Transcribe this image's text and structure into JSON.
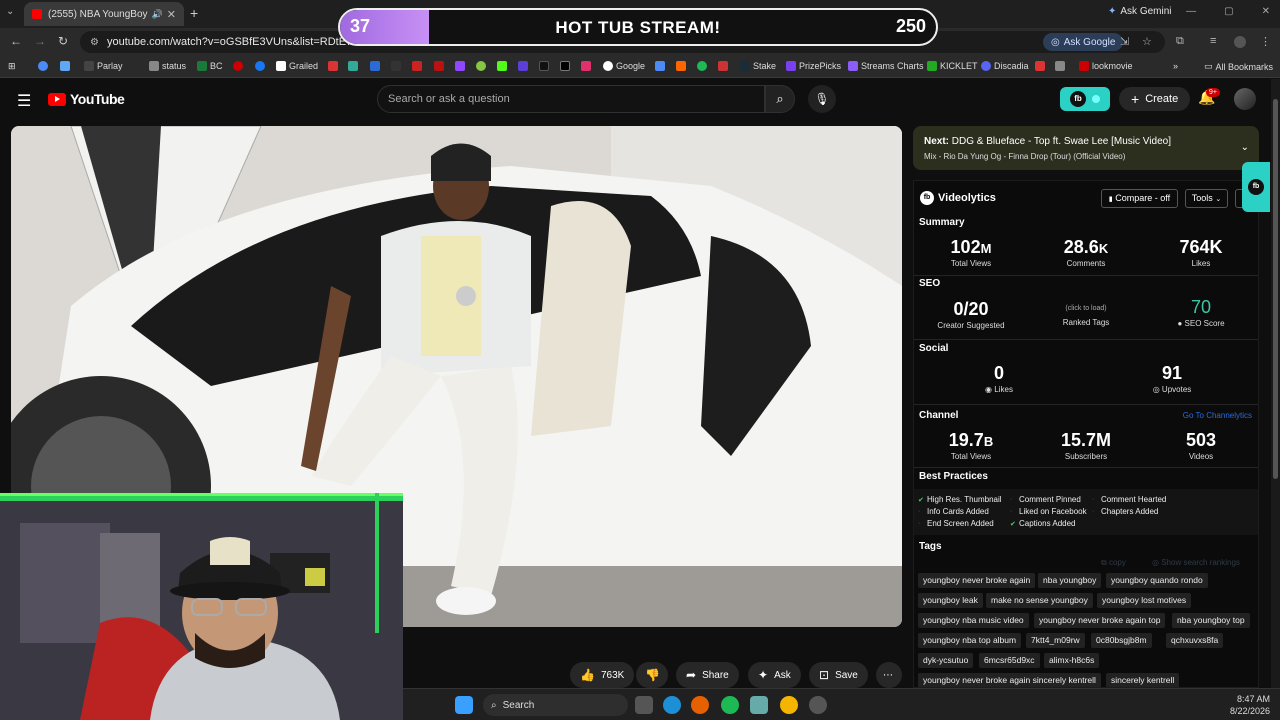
{
  "browser": {
    "tab_title": "(2555) NBA YoungBoy - Ve",
    "ask_gemini": "Ask Gemini",
    "url": "youtube.com/watch?v=oGSBfE3VUns&list=RDtE7dObBU6",
    "ask_google": "Ask Google",
    "bookmarks": [
      "Parlay",
      "status",
      "BC",
      "Grailed",
      "Google",
      "Stake",
      "PrizePicks",
      "Streams Charts",
      "KICKLET",
      "Discadia",
      "lookmovie"
    ],
    "all_bookmarks": "All Bookmarks"
  },
  "stream_overlay": {
    "left_value": "37",
    "title": "HOT TUB STREAM!",
    "right_value": "250",
    "progress": 0.15
  },
  "youtube": {
    "logo_text": "YouTube",
    "search_placeholder": "Search or ask a question",
    "create_label": "Create",
    "notif_badge": "9+"
  },
  "actions": {
    "likes": "763K",
    "share": "Share",
    "ask": "Ask",
    "save": "Save",
    "more": "⋯"
  },
  "next": {
    "label": "Next:",
    "title": "DDG & Blueface - Top ft. Swae Lee [Music Video]",
    "subtitle": "Mix - Rio Da Yung Og - Finna Drop (Tour) (Official Video)"
  },
  "videolytics": {
    "title": "Videolytics",
    "compare": "Compare - off",
    "tools": "Tools",
    "summary": {
      "heading": "Summary",
      "views": {
        "value": "102",
        "suffix": "M",
        "label": "Total Views"
      },
      "comments": {
        "value": "28.6",
        "suffix": "K",
        "label": "Comments"
      },
      "likes": {
        "value": "764K",
        "label": "Likes"
      }
    },
    "seo": {
      "heading": "SEO",
      "creator_suggested": {
        "value": "0/20",
        "label": "Creator Suggested"
      },
      "ranked_tags": {
        "hint": "(click to load)",
        "label": "Ranked Tags"
      },
      "score": {
        "value": "70",
        "label": "SEO Score"
      }
    },
    "social": {
      "heading": "Social",
      "likes": {
        "value": "0",
        "label": "Likes"
      },
      "upvotes": {
        "value": "91",
        "label": "Upvotes"
      }
    },
    "channel": {
      "heading": "Channel",
      "link": "Go To Channelytics",
      "views": {
        "value": "19.7",
        "suffix": "B",
        "label": "Total Views"
      },
      "subscribers": {
        "value": "15.7M",
        "label": "Subscribers"
      },
      "videos": {
        "value": "503",
        "label": "Videos"
      }
    },
    "best_practices": {
      "heading": "Best Practices",
      "items": [
        {
          "label": "High Res. Thumbnail",
          "ok": true
        },
        {
          "label": "Comment Pinned",
          "ok": false
        },
        {
          "label": "Comment Hearted",
          "ok": false
        },
        {
          "label": "Info Cards Added",
          "ok": false
        },
        {
          "label": "Liked on Facebook",
          "ok": false
        },
        {
          "label": "Chapters Added",
          "ok": false
        },
        {
          "label": "End Screen Added",
          "ok": false
        },
        {
          "label": "Captions Added",
          "ok": true
        }
      ]
    },
    "tags": {
      "heading": "Tags",
      "copy": "copy",
      "show_rankings": "Show search rankings",
      "items": [
        "youngboy never broke again",
        "nba youngboy",
        "youngboy quando rondo",
        "youngboy leak",
        "make no sense youngboy",
        "youngboy lost motives",
        "youngboy nba music video",
        "youngboy never broke again top",
        "nba youngboy top",
        "youngboy nba top album",
        "7ktt4_m09rw",
        "0c80bsgjb8m",
        "qchxuvxs8fa",
        "dyk-ycsutuo",
        "6mcsr65d9xc",
        "alimx-h8c6s",
        "youngboy never broke again sincerely kentrell",
        "sincerely kentrell"
      ]
    }
  },
  "taskbar": {
    "search": "Search",
    "time": "8:47 AM",
    "date": "8/22/2026"
  }
}
